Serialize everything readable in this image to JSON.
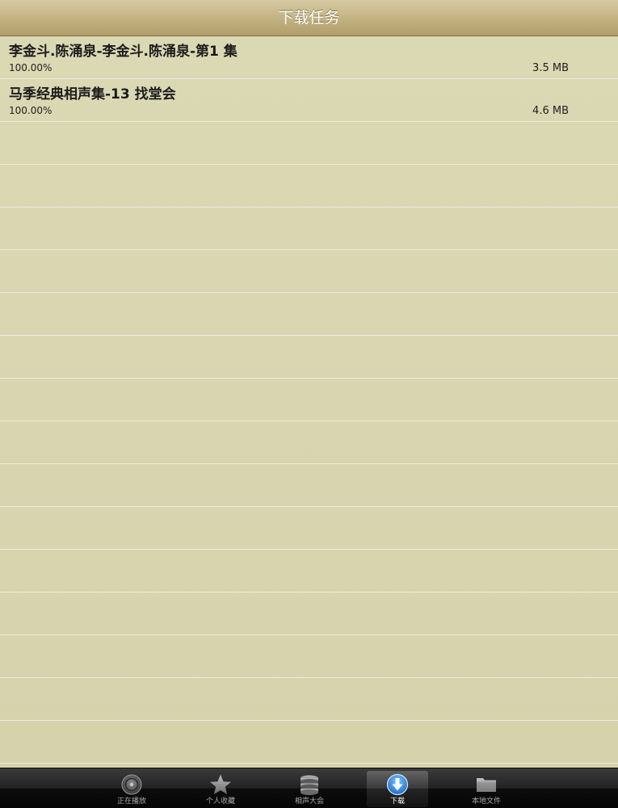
{
  "nav": {
    "title": "下载任务"
  },
  "downloads": [
    {
      "title": "李金斗.陈涌泉-李金斗.陈涌泉-第1 集",
      "progress": "100.00%",
      "size": "3.5 MB"
    },
    {
      "title": "马季经典相声集-13 找堂会",
      "progress": "100.00%",
      "size": "4.6 MB"
    }
  ],
  "tabbar": {
    "tabs": [
      {
        "label": "正在播放",
        "icon": "now-playing-icon",
        "selected": false
      },
      {
        "label": "个人收藏",
        "icon": "star-icon",
        "selected": false
      },
      {
        "label": "相声大会",
        "icon": "database-icon",
        "selected": false
      },
      {
        "label": "下载",
        "icon": "download-icon",
        "selected": true
      },
      {
        "label": "本地文件",
        "icon": "folder-icon",
        "selected": false
      }
    ]
  },
  "colors": {
    "background": "#d9d6b1",
    "navbar": "#c6b686",
    "tabbar": "#1a1a1a",
    "selected_icon": "#2f8fd8"
  }
}
